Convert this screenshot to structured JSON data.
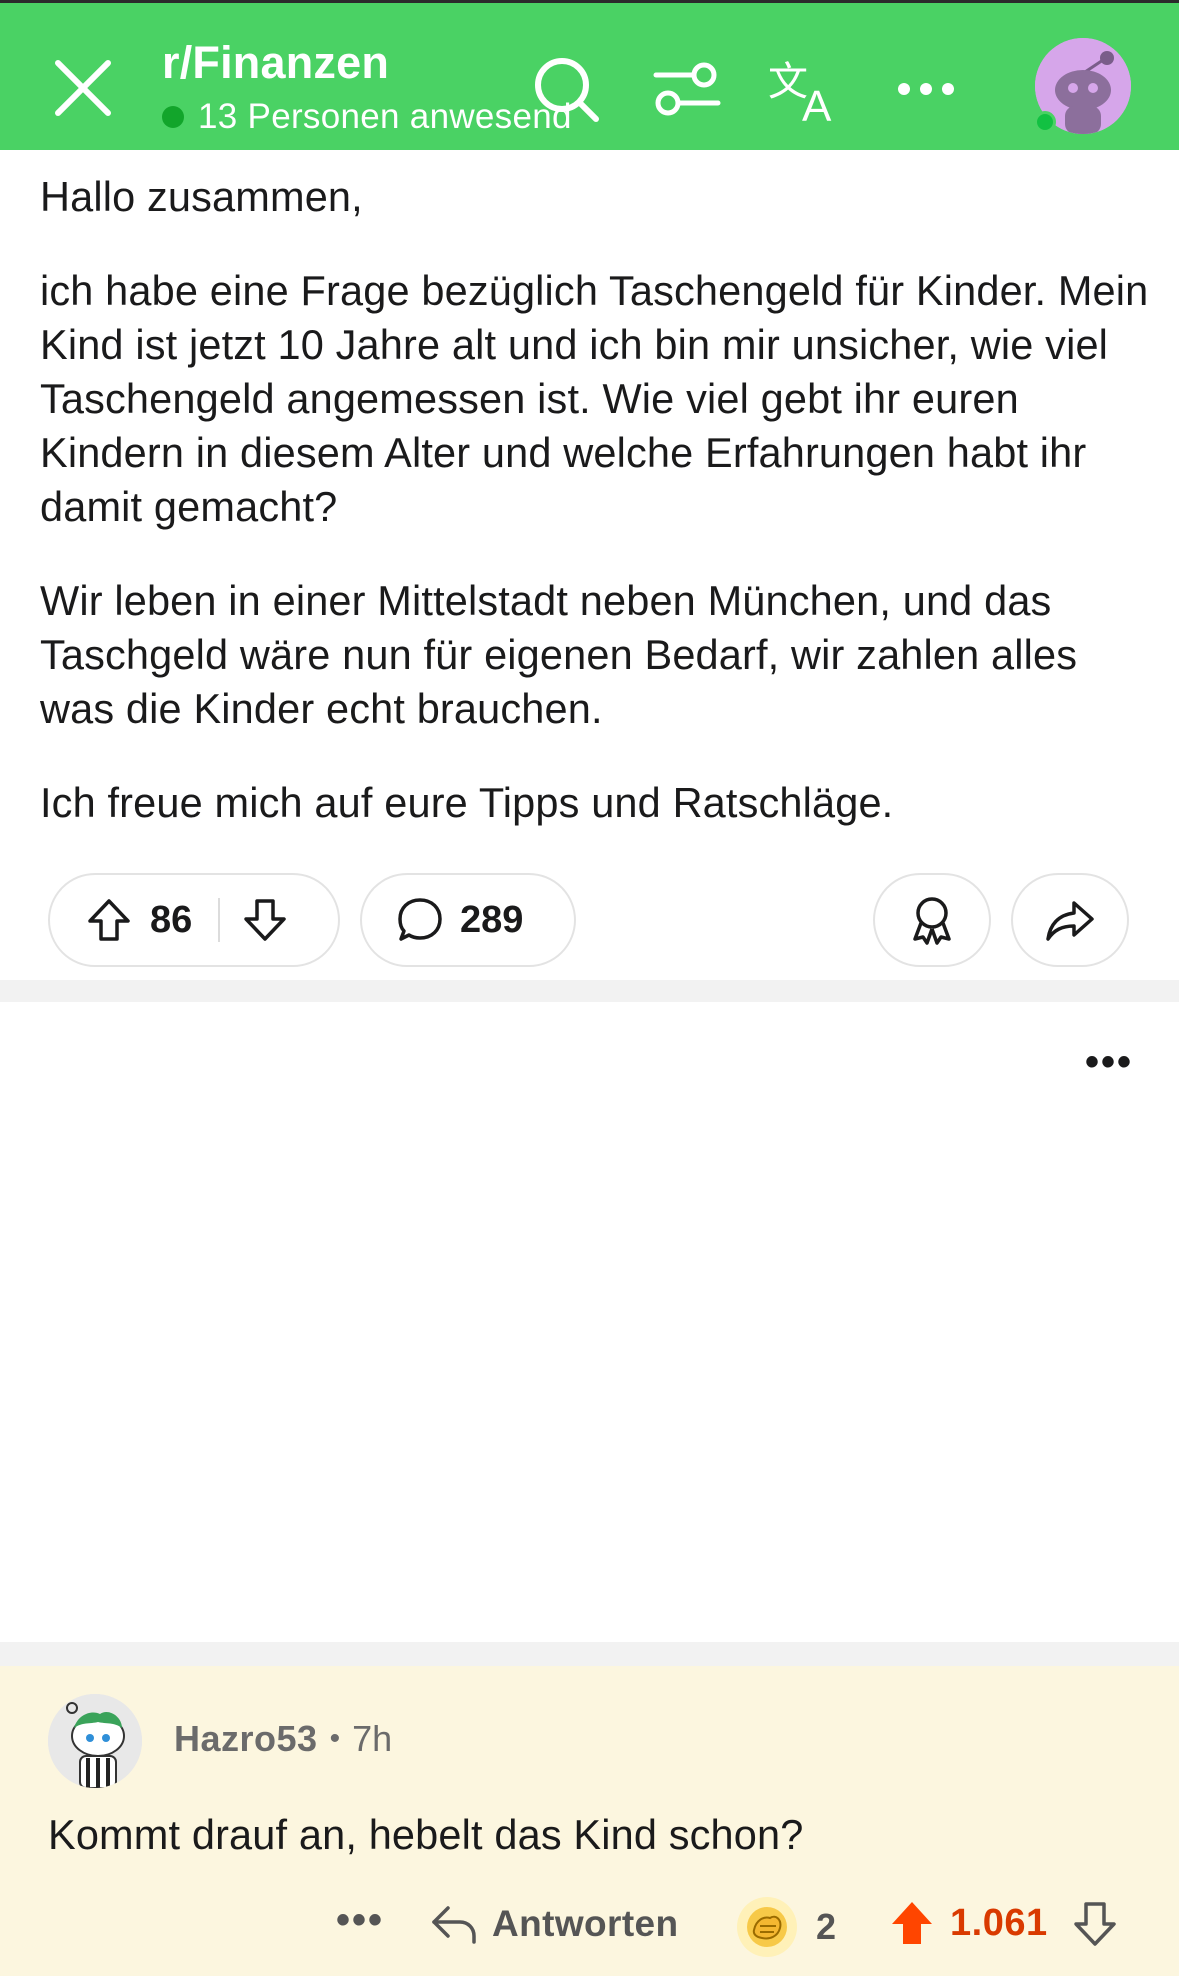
{
  "header": {
    "subreddit": "r/Finanzen",
    "presence": "13 Personen anwesend",
    "colors": {
      "bar": "#4ad264",
      "online": "#12a52b"
    }
  },
  "post": {
    "paragraphs": [
      "Hallo zusammen,",
      "ich habe eine Frage bezüglich Taschengeld für Kinder. Mein Kind ist jetzt 10 Jahre alt und ich bin mir unsicher, wie viel Taschengeld angemessen ist. Wie viel gebt ihr euren Kindern in diesem Alter und welche Erfahrungen habt ihr damit gemacht?",
      "Wir leben in einer Mittelstadt neben München, und das Taschgeld wäre nun für eigenen Bedarf, wir zahlen alles was die Kinder echt brauchen.",
      "Ich freue mich auf eure Tipps und Ratschläge."
    ],
    "actions": {
      "upvotes": "86",
      "comments": "289"
    }
  },
  "middle": {
    "more": "•••"
  },
  "comment": {
    "username": "Hazro53",
    "separator": "•",
    "time": "7h",
    "text": "Kommt drauf an, hebelt das Kind schon?",
    "more": "•••",
    "reply_label": "Antworten",
    "award_count": "2",
    "score": "1.061",
    "colors": {
      "background": "#fcf6df",
      "upvote": "#d93a00"
    }
  }
}
